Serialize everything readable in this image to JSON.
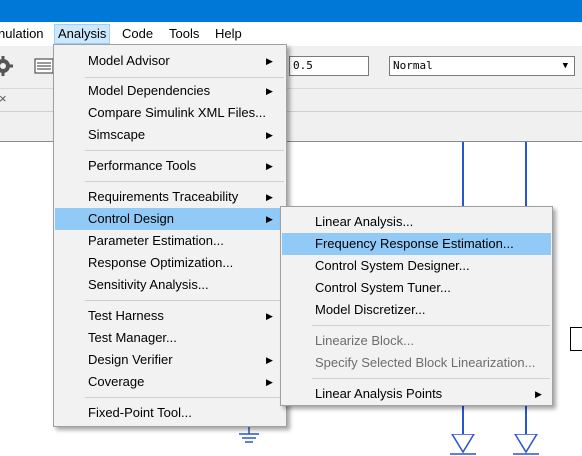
{
  "menubar": {
    "items": [
      {
        "label": "nulation"
      },
      {
        "label": "Analysis"
      },
      {
        "label": "Code"
      },
      {
        "label": "Tools"
      },
      {
        "label": "Help"
      }
    ]
  },
  "toolbar": {
    "stop_time": "0.5",
    "sim_mode": "Normal"
  },
  "tab_close": "×",
  "analysis_menu": {
    "items": [
      {
        "label": "Model Advisor",
        "submenu": true
      },
      {
        "label": "Model Dependencies",
        "submenu": true
      },
      {
        "label": "Compare Simulink XML Files...",
        "submenu": false
      },
      {
        "label": "Simscape",
        "submenu": true
      },
      {
        "label": "Performance Tools",
        "submenu": true
      },
      {
        "label": "Requirements Traceability",
        "submenu": true
      },
      {
        "label": "Control Design",
        "submenu": true
      },
      {
        "label": "Parameter Estimation...",
        "submenu": false
      },
      {
        "label": "Response Optimization...",
        "submenu": false
      },
      {
        "label": "Sensitivity Analysis...",
        "submenu": false
      },
      {
        "label": "Test Harness",
        "submenu": true
      },
      {
        "label": "Test Manager...",
        "submenu": false
      },
      {
        "label": "Design Verifier",
        "submenu": true
      },
      {
        "label": "Coverage",
        "submenu": true
      },
      {
        "label": "Fixed-Point Tool...",
        "submenu": false
      }
    ]
  },
  "control_design_menu": {
    "items": [
      {
        "label": "Linear Analysis...",
        "enabled": true
      },
      {
        "label": "Frequency Response Estimation...",
        "enabled": true
      },
      {
        "label": "Control System Designer...",
        "enabled": true
      },
      {
        "label": "Control System Tuner...",
        "enabled": true
      },
      {
        "label": "Model Discretizer...",
        "enabled": true
      },
      {
        "label": "Linearize Block...",
        "enabled": false
      },
      {
        "label": "Specify Selected Block Linearization...",
        "enabled": false
      },
      {
        "label": "Linear Analysis Points",
        "enabled": true,
        "submenu": true
      }
    ]
  },
  "colors": {
    "titlebar": "#0078d7",
    "menu_highlight": "#91c9f7",
    "wire": "#2a55d0"
  }
}
